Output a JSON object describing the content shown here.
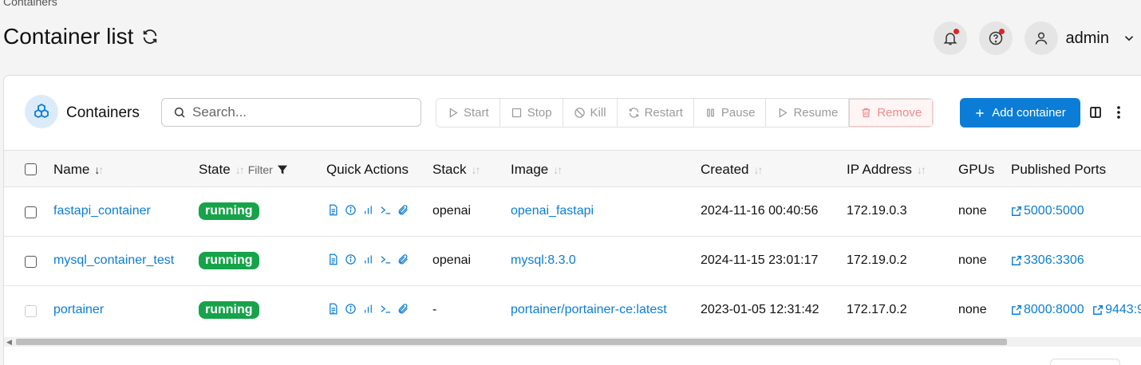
{
  "breadcrumb": "Containers",
  "page_title": "Container list",
  "user": {
    "name": "admin"
  },
  "toolbar": {
    "title": "Containers",
    "search_placeholder": "Search...",
    "actions": {
      "start": "Start",
      "stop": "Stop",
      "kill": "Kill",
      "restart": "Restart",
      "pause": "Pause",
      "resume": "Resume",
      "remove": "Remove"
    },
    "add_label": "Add container"
  },
  "columns": {
    "name": "Name",
    "state": "State",
    "filter": "Filter",
    "quick_actions": "Quick Actions",
    "stack": "Stack",
    "image": "Image",
    "created": "Created",
    "ip": "IP Address",
    "gpus": "GPUs",
    "ports": "Published Ports"
  },
  "rows": [
    {
      "name": "fastapi_container",
      "state": "running",
      "stack": "openai",
      "image": "openai_fastapi",
      "created": "2024-11-16 00:40:56",
      "ip": "172.19.0.3",
      "gpus": "none",
      "ports": [
        "5000:5000"
      ]
    },
    {
      "name": "mysql_container_test",
      "state": "running",
      "stack": "openai",
      "image": "mysql:8.3.0",
      "created": "2024-11-15 23:01:17",
      "ip": "172.19.0.2",
      "gpus": "none",
      "ports": [
        "3306:3306"
      ]
    },
    {
      "name": "portainer",
      "state": "running",
      "stack": "-",
      "image": "portainer/portainer-ce:latest",
      "created": "2023-01-05 12:31:42",
      "ip": "172.17.0.2",
      "gpus": "none",
      "ports": [
        "8000:8000",
        "9443:9"
      ]
    }
  ],
  "colors": {
    "accent": "#0b7dd6",
    "running": "#16a34a",
    "danger": "#e02424"
  }
}
